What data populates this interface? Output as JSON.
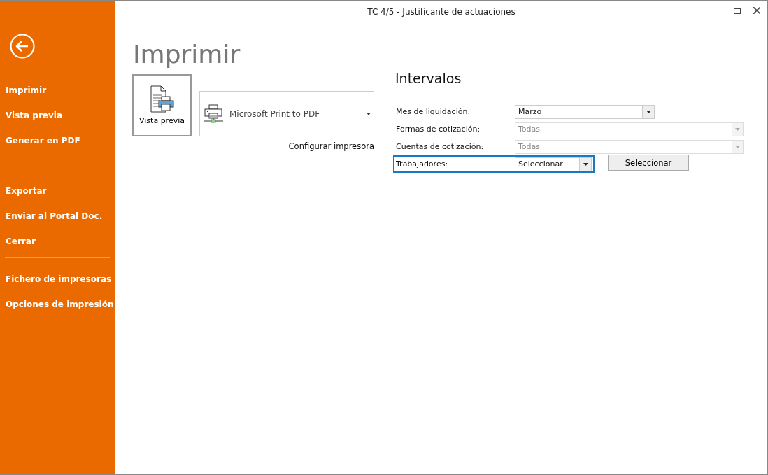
{
  "window": {
    "title": "TC 4/5 - Justificante de actuaciones"
  },
  "sidebar": {
    "groups": [
      {
        "kind": "first",
        "items": [
          "Imprimir",
          "Vista previa",
          "Generar en PDF"
        ]
      },
      {
        "kind": "spaced",
        "items": [
          "Exportar",
          "Enviar al Portal Doc.",
          "Cerrar"
        ]
      },
      {
        "kind": "divided",
        "items": [
          "Fichero de impresoras",
          "Opciones de impresión"
        ]
      }
    ]
  },
  "heading": "Imprimir",
  "preview_button": {
    "label": "Vista previa"
  },
  "printer": {
    "name": "Microsoft Print to PDF"
  },
  "configure_link": "Configurar impresora",
  "intervals": {
    "title": "Intervalos",
    "rows": [
      {
        "label": "Mes de liquidación:",
        "value": "Marzo",
        "disabled": false,
        "focused": false
      },
      {
        "label": "Formas de cotización:",
        "value": "Todas",
        "disabled": true,
        "focused": false
      },
      {
        "label": "Cuentas de cotización:",
        "value": "Todas",
        "disabled": true,
        "focused": false
      },
      {
        "label": "Trabajadores:",
        "value": "Seleccionar",
        "disabled": false,
        "focused": true,
        "button": "Seleccionar"
      }
    ]
  }
}
